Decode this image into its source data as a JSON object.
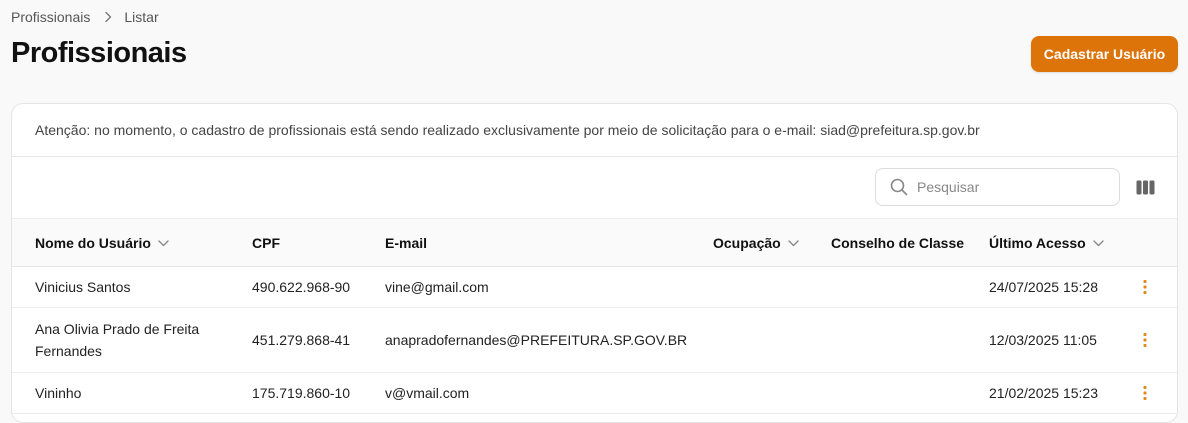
{
  "breadcrumb": {
    "root": "Profissionais",
    "current": "Listar"
  },
  "page": {
    "title": "Profissionais",
    "primary_button": "Cadastrar Usuário"
  },
  "notice": "Atenção: no momento, o cadastro de profissionais está sendo realizado exclusivamente por meio de solicitação para o e-mail: siad@prefeitura.sp.gov.br",
  "search": {
    "placeholder": "Pesquisar",
    "value": ""
  },
  "table": {
    "columns": [
      {
        "label": "Nome do Usuário",
        "sortable": true
      },
      {
        "label": "CPF",
        "sortable": false
      },
      {
        "label": "E-mail",
        "sortable": false
      },
      {
        "label": "Ocupação",
        "sortable": true
      },
      {
        "label": "Conselho de Classe",
        "sortable": false
      },
      {
        "label": "Último Acesso",
        "sortable": true
      }
    ],
    "rows": [
      {
        "name": "Vinicius Santos",
        "cpf": "490.622.968-90",
        "email": "vine@gmail.com",
        "ocupacao": "",
        "conselho": "",
        "ultimo_acesso": "24/07/2025 15:28"
      },
      {
        "name": "Ana Olivia Prado de Freita Fernandes",
        "cpf": "451.279.868-41",
        "email": "anapradofernandes@PREFEITURA.SP.GOV.BR",
        "ocupacao": "",
        "conselho": "",
        "ultimo_acesso": "12/03/2025 11:05"
      },
      {
        "name": "Vininho",
        "cpf": "175.719.860-10",
        "email": "v@vmail.com",
        "ocupacao": "",
        "conselho": "",
        "ultimo_acesso": "21/02/2025 15:23"
      }
    ]
  },
  "colors": {
    "accent": "#dc7409",
    "kebab": "#e08a1e",
    "text": "#111111",
    "muted": "#555555"
  },
  "icons": [
    "chevron-right-icon",
    "search-icon",
    "columns-icon",
    "chevron-down-icon",
    "kebab-menu-icon"
  ]
}
